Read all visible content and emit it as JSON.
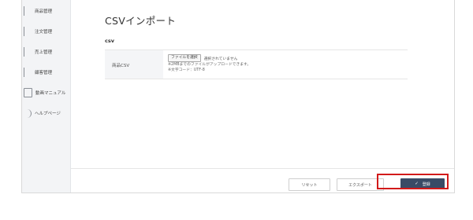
{
  "sidebar": {
    "items": [
      {
        "label": "商品管理"
      },
      {
        "label": "注文管理"
      },
      {
        "label": "売上管理"
      },
      {
        "label": "顧客管理"
      },
      {
        "label": "動画マニュアル"
      },
      {
        "label": "ヘルプページ"
      }
    ]
  },
  "page": {
    "title": "CSVインポート"
  },
  "section": {
    "heading": "csv"
  },
  "csv_row": {
    "label": "商品CSV",
    "file_button": "ファイルを選択",
    "file_status": "選択されていません",
    "note1": "※2MBまでのファイルがアップロードできます。",
    "note2": "※文字コード：UTF-8"
  },
  "footer": {
    "reset": "リセット",
    "export": "エクスポート",
    "register_check": "✓",
    "register": "登録"
  },
  "colors": {
    "primary_button": "#394b66",
    "highlight": "#d21a1a",
    "sidebar_bg": "#f3f4f6"
  }
}
